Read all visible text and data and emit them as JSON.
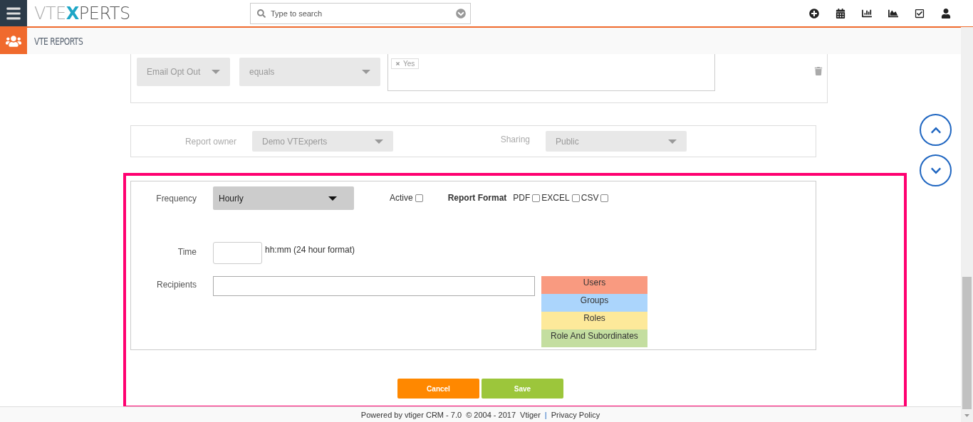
{
  "header": {
    "logo": {
      "prefix": "VTE",
      "mark": "X",
      "suffix": "PERTS"
    },
    "search": {
      "placeholder": "Type to search"
    }
  },
  "module": {
    "title": "VTE REPORTS"
  },
  "condition": {
    "field": "Email Opt Out",
    "operator": "equals",
    "tags": [
      "Yes"
    ]
  },
  "ownership": {
    "owner_label": "Report owner",
    "owner": "Demo VTExperts",
    "sharing_label": "Sharing",
    "sharing": "Public"
  },
  "schedule": {
    "frequency_label": "Frequency",
    "frequency": "Hourly",
    "active_label": "Active",
    "active": false,
    "format_label": "Report Format",
    "formats": [
      {
        "label": "PDF",
        "checked": false
      },
      {
        "label": "EXCEL",
        "checked": false
      },
      {
        "label": "CSV",
        "checked": false
      }
    ],
    "time_label": "Time",
    "time_hint": "hh:mm (24 hour format)",
    "recipients_label": "Recipients",
    "recipient_types": [
      {
        "label": "Users",
        "color": "#f99a80"
      },
      {
        "label": "Groups",
        "color": "#abd5fc"
      },
      {
        "label": "Roles",
        "color": "#fde99a"
      },
      {
        "label": "Role And Subordinates",
        "color": "#c4dea0"
      }
    ]
  },
  "buttons": {
    "cancel": "Cancel",
    "save": "Save"
  },
  "footer": {
    "text": "Powered by vtiger CRM - 7.0  © 2004 - 2017",
    "link": "Vtiger",
    "separator": "|",
    "privacy": "Privacy Policy"
  }
}
